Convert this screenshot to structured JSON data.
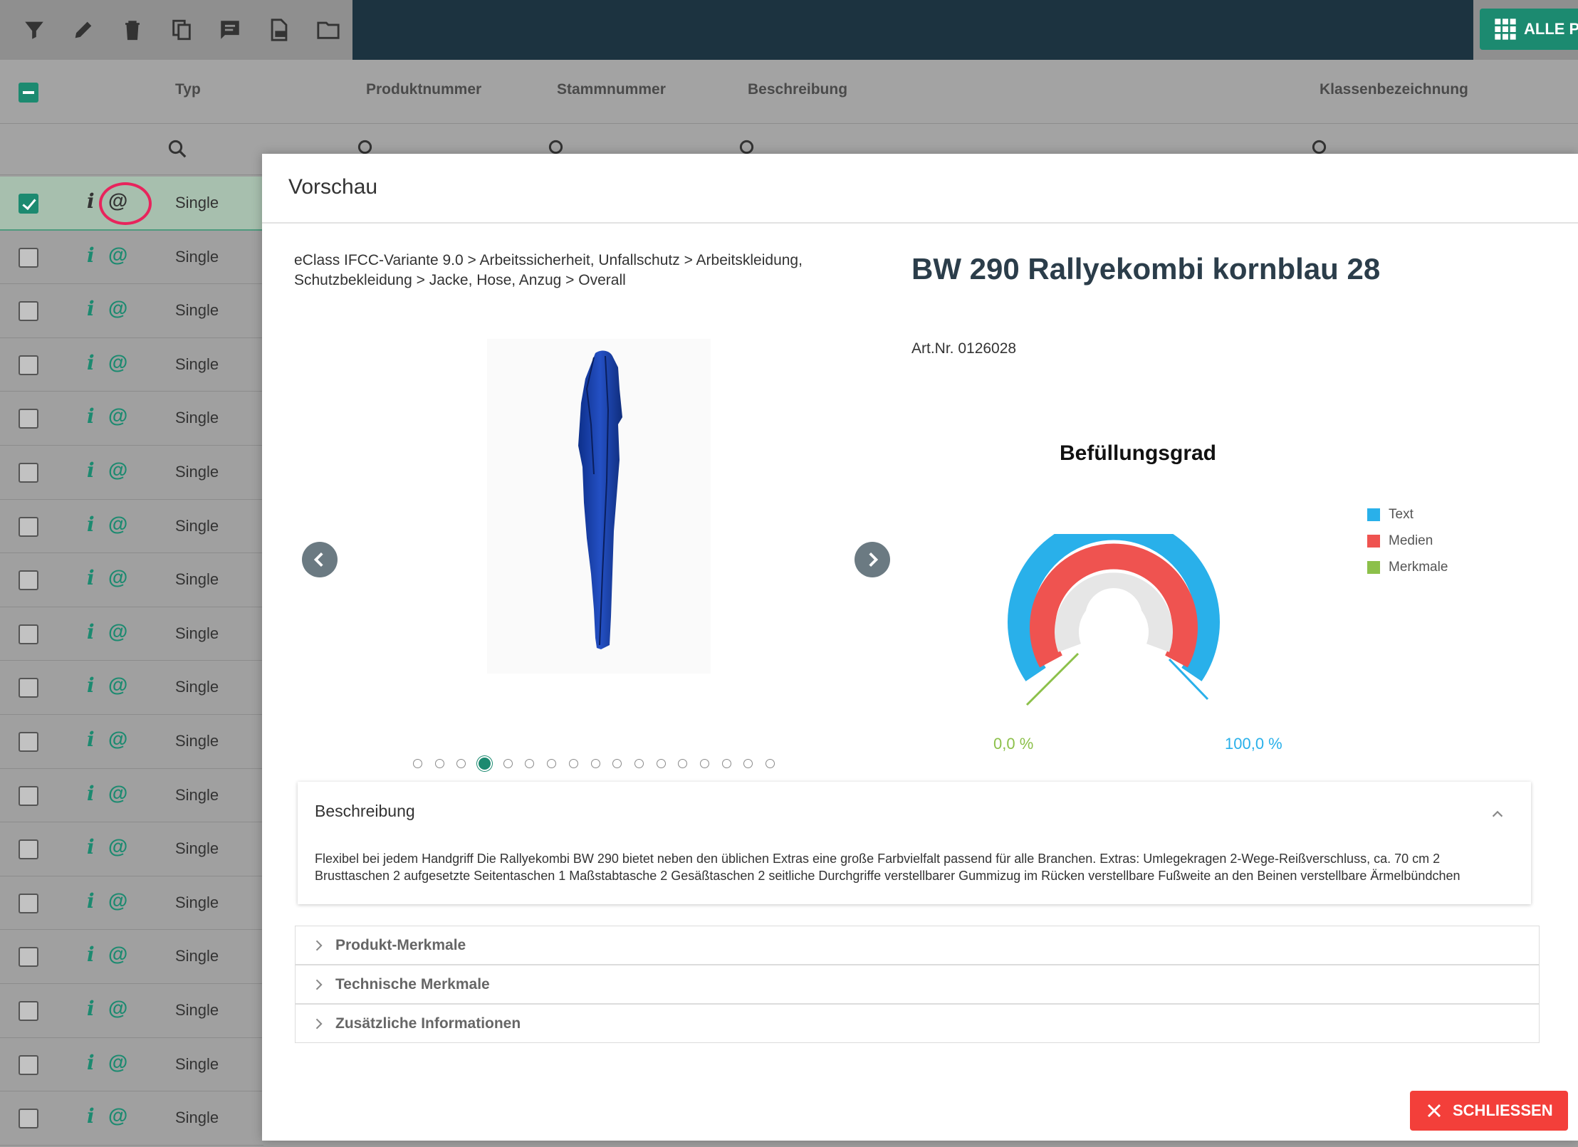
{
  "toolbar": {
    "all_button_label": "ALLE P",
    "icons": [
      "filter-icon",
      "edit-icon",
      "delete-icon",
      "copy-icon",
      "comment-icon",
      "export-icon",
      "folder-icon",
      "grid-icon"
    ]
  },
  "grid": {
    "headers": [
      "Typ",
      "Produktnummer",
      "Stammnummer",
      "Beschreibung",
      "Klassenbezeichnung"
    ],
    "rows": [
      {
        "typ": "Single",
        "selected": true
      },
      {
        "typ": "Single"
      },
      {
        "typ": "Single"
      },
      {
        "typ": "Single"
      },
      {
        "typ": "Single"
      },
      {
        "typ": "Single"
      },
      {
        "typ": "Single"
      },
      {
        "typ": "Single"
      },
      {
        "typ": "Single"
      },
      {
        "typ": "Single"
      },
      {
        "typ": "Single"
      },
      {
        "typ": "Single"
      },
      {
        "typ": "Single"
      },
      {
        "typ": "Single"
      },
      {
        "typ": "Single"
      },
      {
        "typ": "Single"
      },
      {
        "typ": "Single"
      },
      {
        "typ": "Single"
      }
    ],
    "info_glyph": "i",
    "at_glyph": "@"
  },
  "modal": {
    "title": "Vorschau",
    "breadcrumb": "eClass IFCC-Variante 9.0 > Arbeitssicherheit, Unfallschutz > Arbeitskleidung, Schutzbekleidung > Jacke, Hose, Anzug > Overall",
    "product_title": "BW 290 Rallyekombi kornblau 28",
    "art_nr": "Art.Nr. 0126028",
    "carousel": {
      "total": 17,
      "active_index": 3
    },
    "chart": {
      "title": "Befüllungsgrad",
      "min_label": "0,0 %",
      "max_label": "100,0 %",
      "legend": [
        {
          "label": "Text",
          "color": "#29b0ea"
        },
        {
          "label": "Medien",
          "color": "#ef5350"
        },
        {
          "label": "Merkmale",
          "color": "#8cc04a"
        }
      ]
    },
    "description": {
      "title": "Beschreibung",
      "text": "Flexibel bei jedem Handgriff  Die Rallyekombi BW 290 bietet neben den üblichen Extras eine große Farbvielfalt passend für alle Branchen.  Extras: Umlegekragen 2-Wege-Reißverschluss, ca. 70 cm 2 Brusttaschen 2 aufgesetzte Seitentaschen 1 Maßstabtasche 2 Gesäßtaschen 2 seitliche Durchgriffe verstellbarer Gummizug im Rücken verstellbare Fußweite an den Beinen verstellbare Ärmelbündchen"
    },
    "accordions": [
      "Produkt-Merkmale",
      "Technische Merkmale",
      "Zusätzliche Informationen"
    ],
    "close_label": "SCHLIESSEN"
  },
  "colors": {
    "accent": "#1c8a70",
    "toolbar_dark": "#1c3340",
    "close_red": "#f33f3a",
    "highlight_ring": "#e8245c"
  }
}
